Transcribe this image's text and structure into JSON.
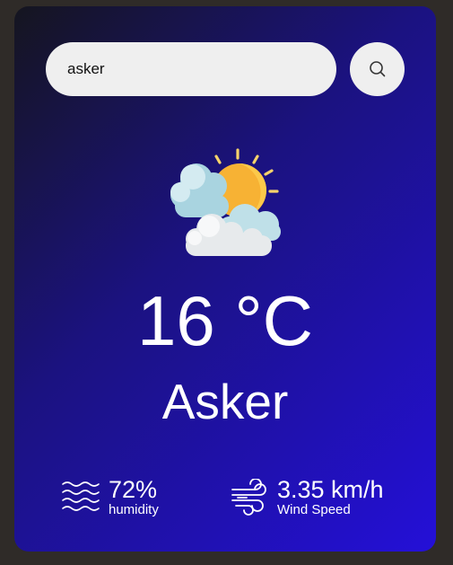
{
  "search": {
    "value": "asker",
    "icon": "search-icon"
  },
  "weather": {
    "icon": "partly-cloudy-icon",
    "temperature": "16 °C",
    "city": "Asker"
  },
  "details": {
    "humidity": {
      "icon": "humidity-waves-icon",
      "value": "72%",
      "label": "humidity"
    },
    "wind": {
      "icon": "wind-icon",
      "value": "3.35 km/h",
      "label": "Wind Speed"
    }
  }
}
